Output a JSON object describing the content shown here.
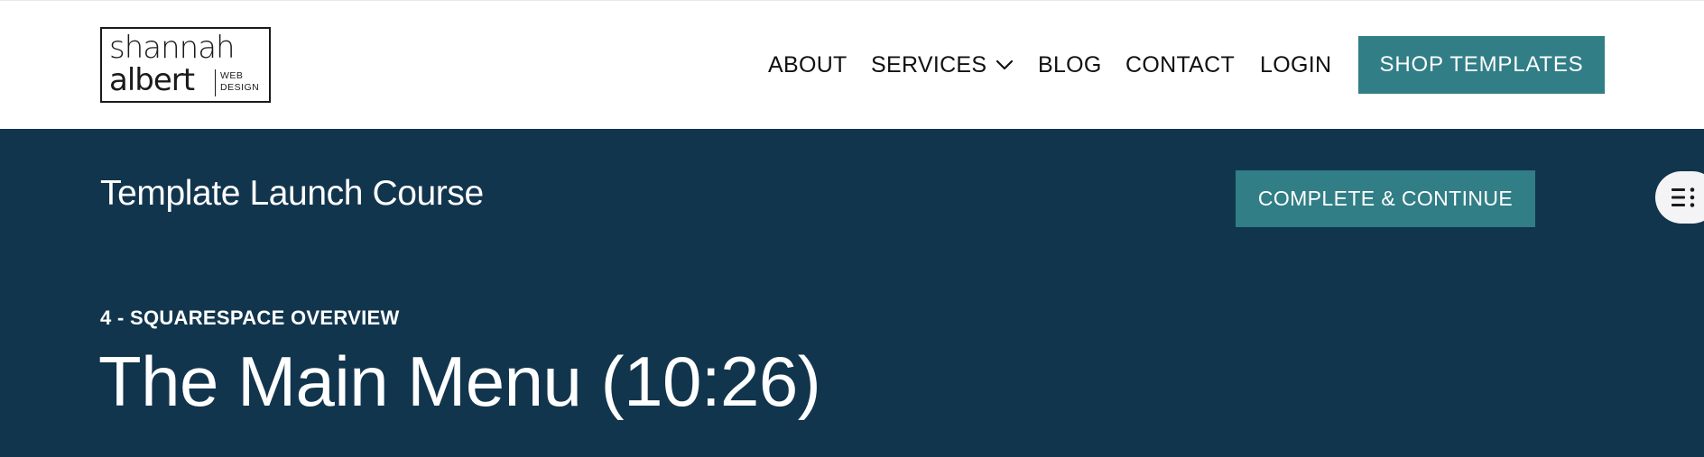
{
  "logo": {
    "line1": "shannah",
    "line2": "albert",
    "sub_line1": "WEB",
    "sub_line2": "DESIGN"
  },
  "nav": {
    "items": [
      {
        "label": "ABOUT"
      },
      {
        "label": "SERVICES"
      },
      {
        "label": "BLOG"
      },
      {
        "label": "CONTACT"
      },
      {
        "label": "LOGIN"
      }
    ],
    "cta_label": "SHOP TEMPLATES"
  },
  "course": {
    "title": "Template Launch Course",
    "complete_label": "COMPLETE & CONTINUE",
    "section_label": "4 - SQUARESPACE OVERVIEW",
    "lesson_title": "The Main Menu (10:26)"
  },
  "icons": {
    "services_dropdown": "chevron-down-icon",
    "outline_toggle": "list-outline-icon"
  },
  "colors": {
    "header_bg": "#ffffff",
    "hero_bg": "#12354e",
    "accent": "#317e86",
    "nav_text": "#111111",
    "toggle_bg": "#f4f4f6"
  }
}
